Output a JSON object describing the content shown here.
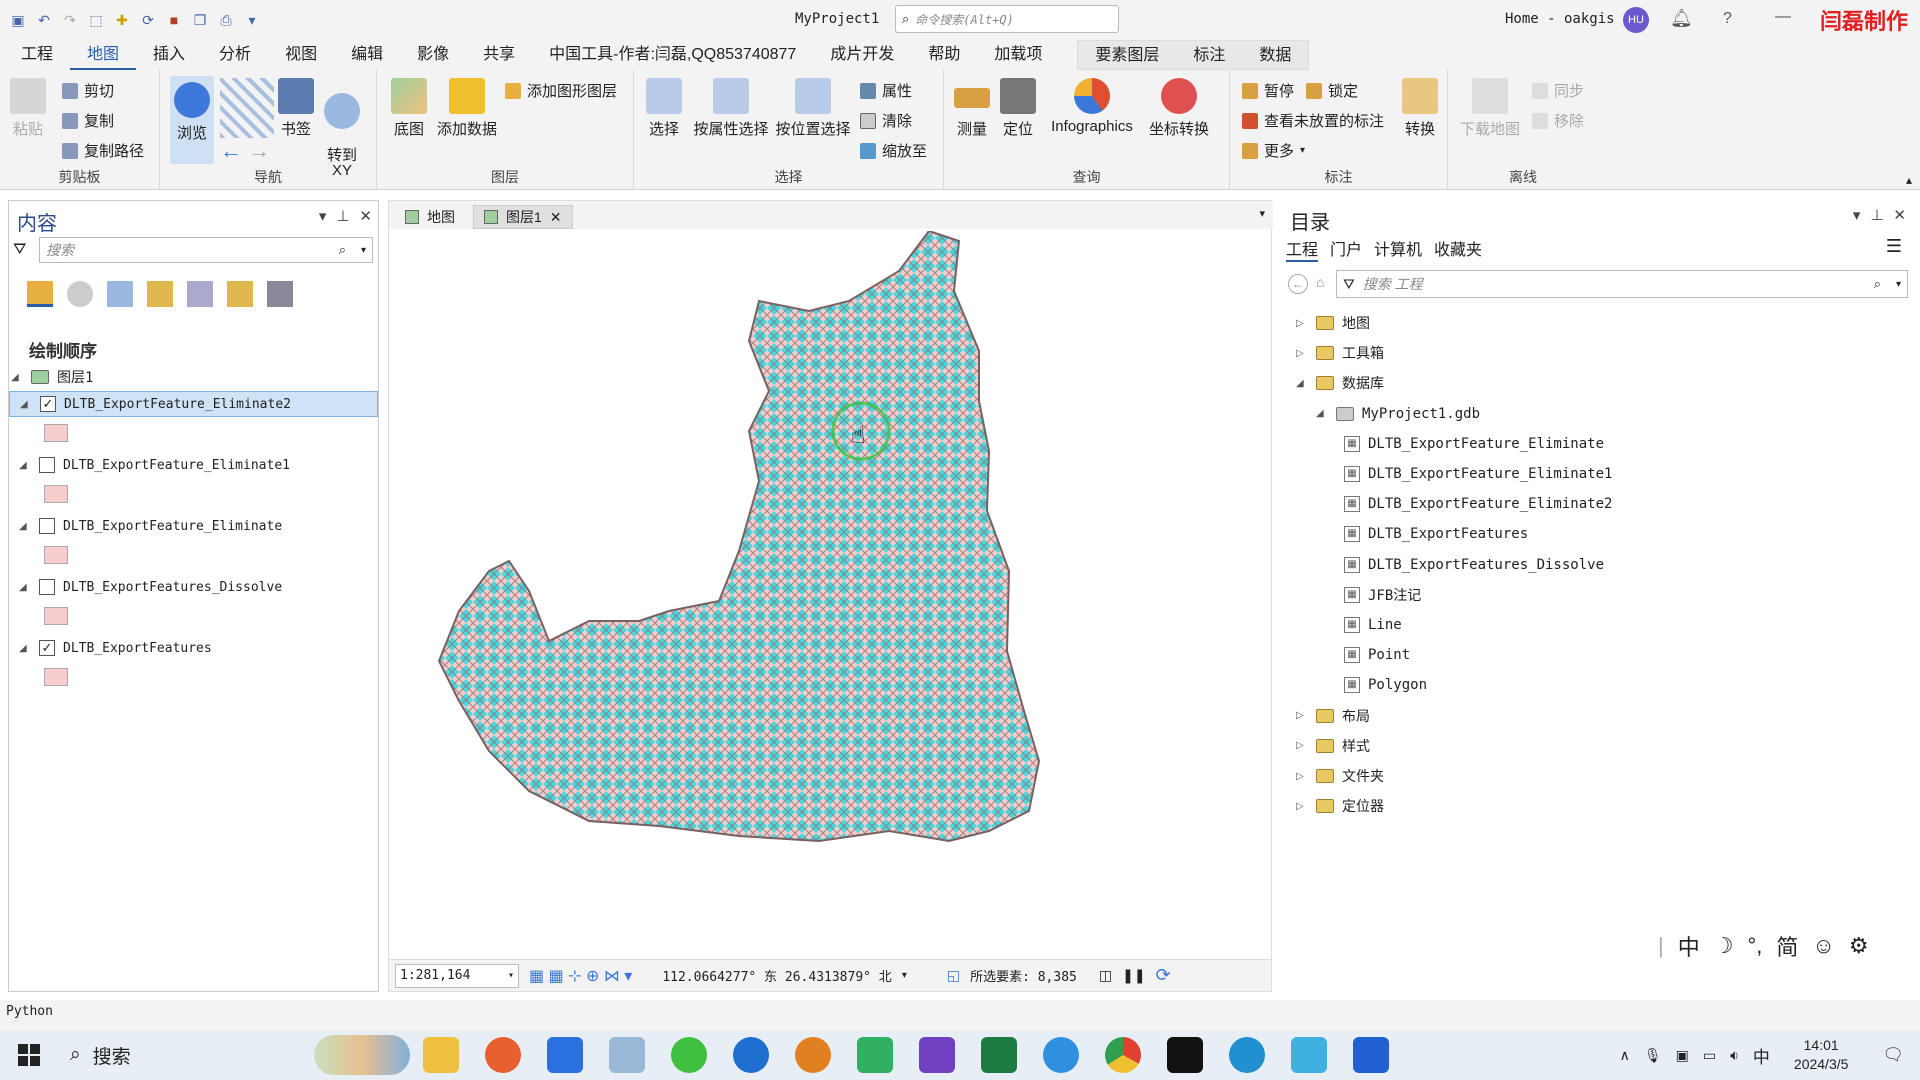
{
  "app": {
    "project": "MyProject1",
    "search_placeholder": "命令搜索(Alt+Q)",
    "user": "Home - oakgis",
    "user_initials": "HU",
    "help": "?",
    "watermark": "闫磊制作"
  },
  "menu": {
    "tabs": [
      "工程",
      "地图",
      "插入",
      "分析",
      "视图",
      "编辑",
      "影像",
      "共享",
      "中国工具-作者:闫磊,QQ853740877",
      "成片开发",
      "帮助",
      "加载项"
    ],
    "active_tab": "地图",
    "context_tabs": [
      "要素图层",
      "标注",
      "数据"
    ]
  },
  "ribbon": {
    "clipboard": {
      "label": "剪贴板",
      "paste": "粘贴",
      "cut": "剪切",
      "copy": "复制",
      "copy_path": "复制路径"
    },
    "navigate": {
      "label": "导航",
      "explore": "浏览",
      "bookmarks": "书签",
      "goto_xy": "转到\nXY"
    },
    "layer": {
      "label": "图层",
      "basemap": "底图",
      "add_data": "添加数据",
      "add_graphics": "添加图形图层"
    },
    "selection": {
      "label": "选择",
      "select": "选择",
      "by_attr": "按属性选择",
      "by_loc": "按位置选择",
      "attributes": "属性",
      "clear": "清除",
      "zoom_to": "缩放至"
    },
    "inquiry": {
      "label": "查询",
      "measure": "测量",
      "locate": "定位",
      "infographics": "Infographics",
      "coord_conv": "坐标转换"
    },
    "labeling": {
      "label": "标注",
      "pause": "暂停",
      "lock": "锁定",
      "unplaced": "查看未放置的标注",
      "more": "更多",
      "convert": "转换"
    },
    "offline": {
      "label": "离线",
      "download": "下载地图",
      "sync": "同步",
      "remove": "移除"
    }
  },
  "contents": {
    "title": "内容",
    "search_placeholder": "搜索",
    "drawing_order": "绘制顺序",
    "map_name": "图层1",
    "layers": [
      {
        "name": "DLTB_ExportFeature_Eliminate2",
        "checked": true,
        "selected": true
      },
      {
        "name": "DLTB_ExportFeature_Eliminate1",
        "checked": false,
        "selected": false
      },
      {
        "name": "DLTB_ExportFeature_Eliminate",
        "checked": false,
        "selected": false
      },
      {
        "name": "DLTB_ExportFeatures_Dissolve",
        "checked": false,
        "selected": false
      },
      {
        "name": "DLTB_ExportFeatures",
        "checked": true,
        "selected": false
      }
    ]
  },
  "mapview": {
    "tabs": [
      {
        "label": "地图",
        "active": false
      },
      {
        "label": "图层1",
        "active": true
      }
    ],
    "scale": "1:281,164",
    "coords": "112.0664277° 东  26.4313879° 北",
    "selected_features": "所选要素: 8,385"
  },
  "catalog": {
    "title": "目录",
    "tabs": [
      "工程",
      "门户",
      "计算机",
      "收藏夹"
    ],
    "active_tab": "工程",
    "search_placeholder": "搜索 工程",
    "items": [
      {
        "label": "地图",
        "level": 0,
        "expanded": false
      },
      {
        "label": "工具箱",
        "level": 0,
        "expanded": false
      },
      {
        "label": "数据库",
        "level": 0,
        "expanded": true
      },
      {
        "label": "MyProject1.gdb",
        "level": 1,
        "expanded": true
      },
      {
        "label": "DLTB_ExportFeature_Eliminate",
        "level": 2
      },
      {
        "label": "DLTB_ExportFeature_Eliminate1",
        "level": 2
      },
      {
        "label": "DLTB_ExportFeature_Eliminate2",
        "level": 2
      },
      {
        "label": "DLTB_ExportFeatures",
        "level": 2
      },
      {
        "label": "DLTB_ExportFeatures_Dissolve",
        "level": 2
      },
      {
        "label": "JFB注记",
        "level": 2
      },
      {
        "label": "Line",
        "level": 2
      },
      {
        "label": "Point",
        "level": 2
      },
      {
        "label": "Polygon",
        "level": 2
      },
      {
        "label": "布局",
        "level": 0,
        "expanded": false
      },
      {
        "label": "样式",
        "level": 0,
        "expanded": false
      },
      {
        "label": "文件夹",
        "level": 0,
        "expanded": false
      },
      {
        "label": "定位器",
        "level": 0,
        "expanded": false
      }
    ]
  },
  "ime": {
    "lang": "中",
    "moon": "☽",
    "punct": "°,",
    "simp": "简",
    "emoji": "☺",
    "gear": "⚙"
  },
  "python_label": "Python",
  "taskbar": {
    "search": "搜索",
    "ime": "中",
    "time": "14:01",
    "date": "2024/3/5"
  },
  "colors": {
    "accent": "#2a5caa",
    "polygon_fill": "#f7cccc",
    "cyan": "#2fd8de",
    "outline": "#8a6f6f"
  }
}
